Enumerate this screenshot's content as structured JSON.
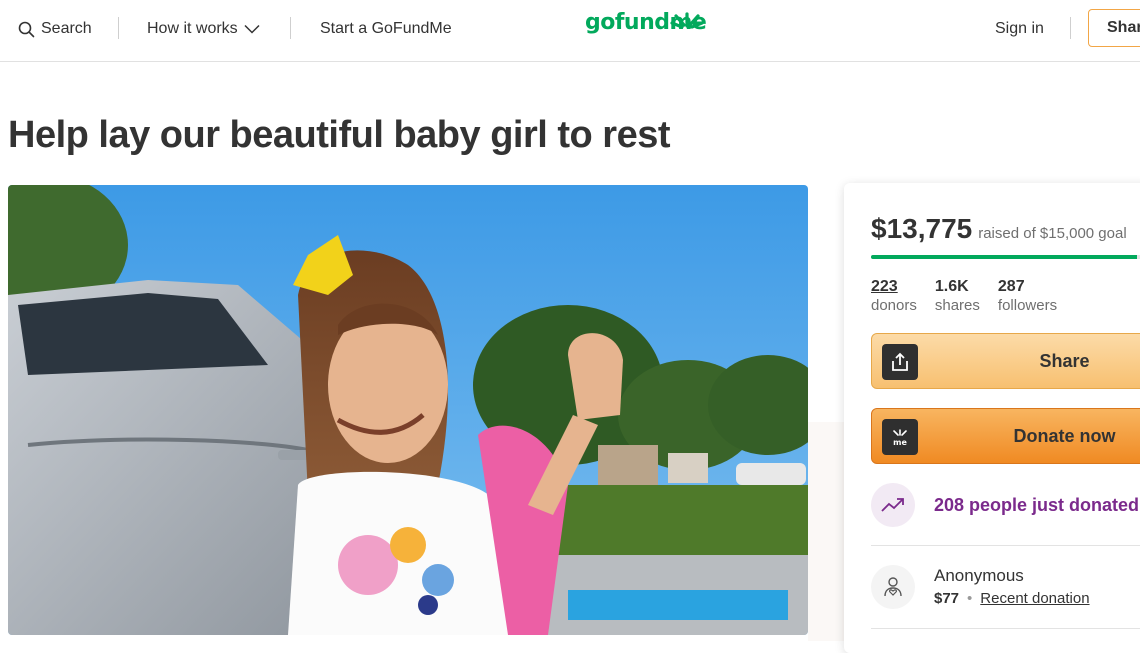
{
  "header": {
    "search_label": "Search",
    "how_it_works_label": "How it works",
    "start_label": "Start a GoFundMe",
    "logo_text": "gofundme",
    "sign_in_label": "Sign in",
    "share_label": "Share"
  },
  "campaign": {
    "title": "Help lay our beautiful baby girl to rest"
  },
  "donation_card": {
    "raised_amount": "$13,775",
    "goal_text": "raised of $15,000 goal",
    "progress_fraction": 0.918,
    "stats": [
      {
        "value": "223",
        "label": "donors"
      },
      {
        "value": "1.6K",
        "label": "shares"
      },
      {
        "value": "287",
        "label": "followers"
      }
    ],
    "share_button": "Share",
    "donate_button": "Donate now",
    "recent_activity": "208 people just donated",
    "latest_donor": {
      "name": "Anonymous",
      "amount": "$77",
      "tag": "Recent donation"
    }
  },
  "colors": {
    "brand_green": "#02a95c",
    "accent_purple": "#7b2a8c",
    "button_orange": "#f08a23"
  }
}
